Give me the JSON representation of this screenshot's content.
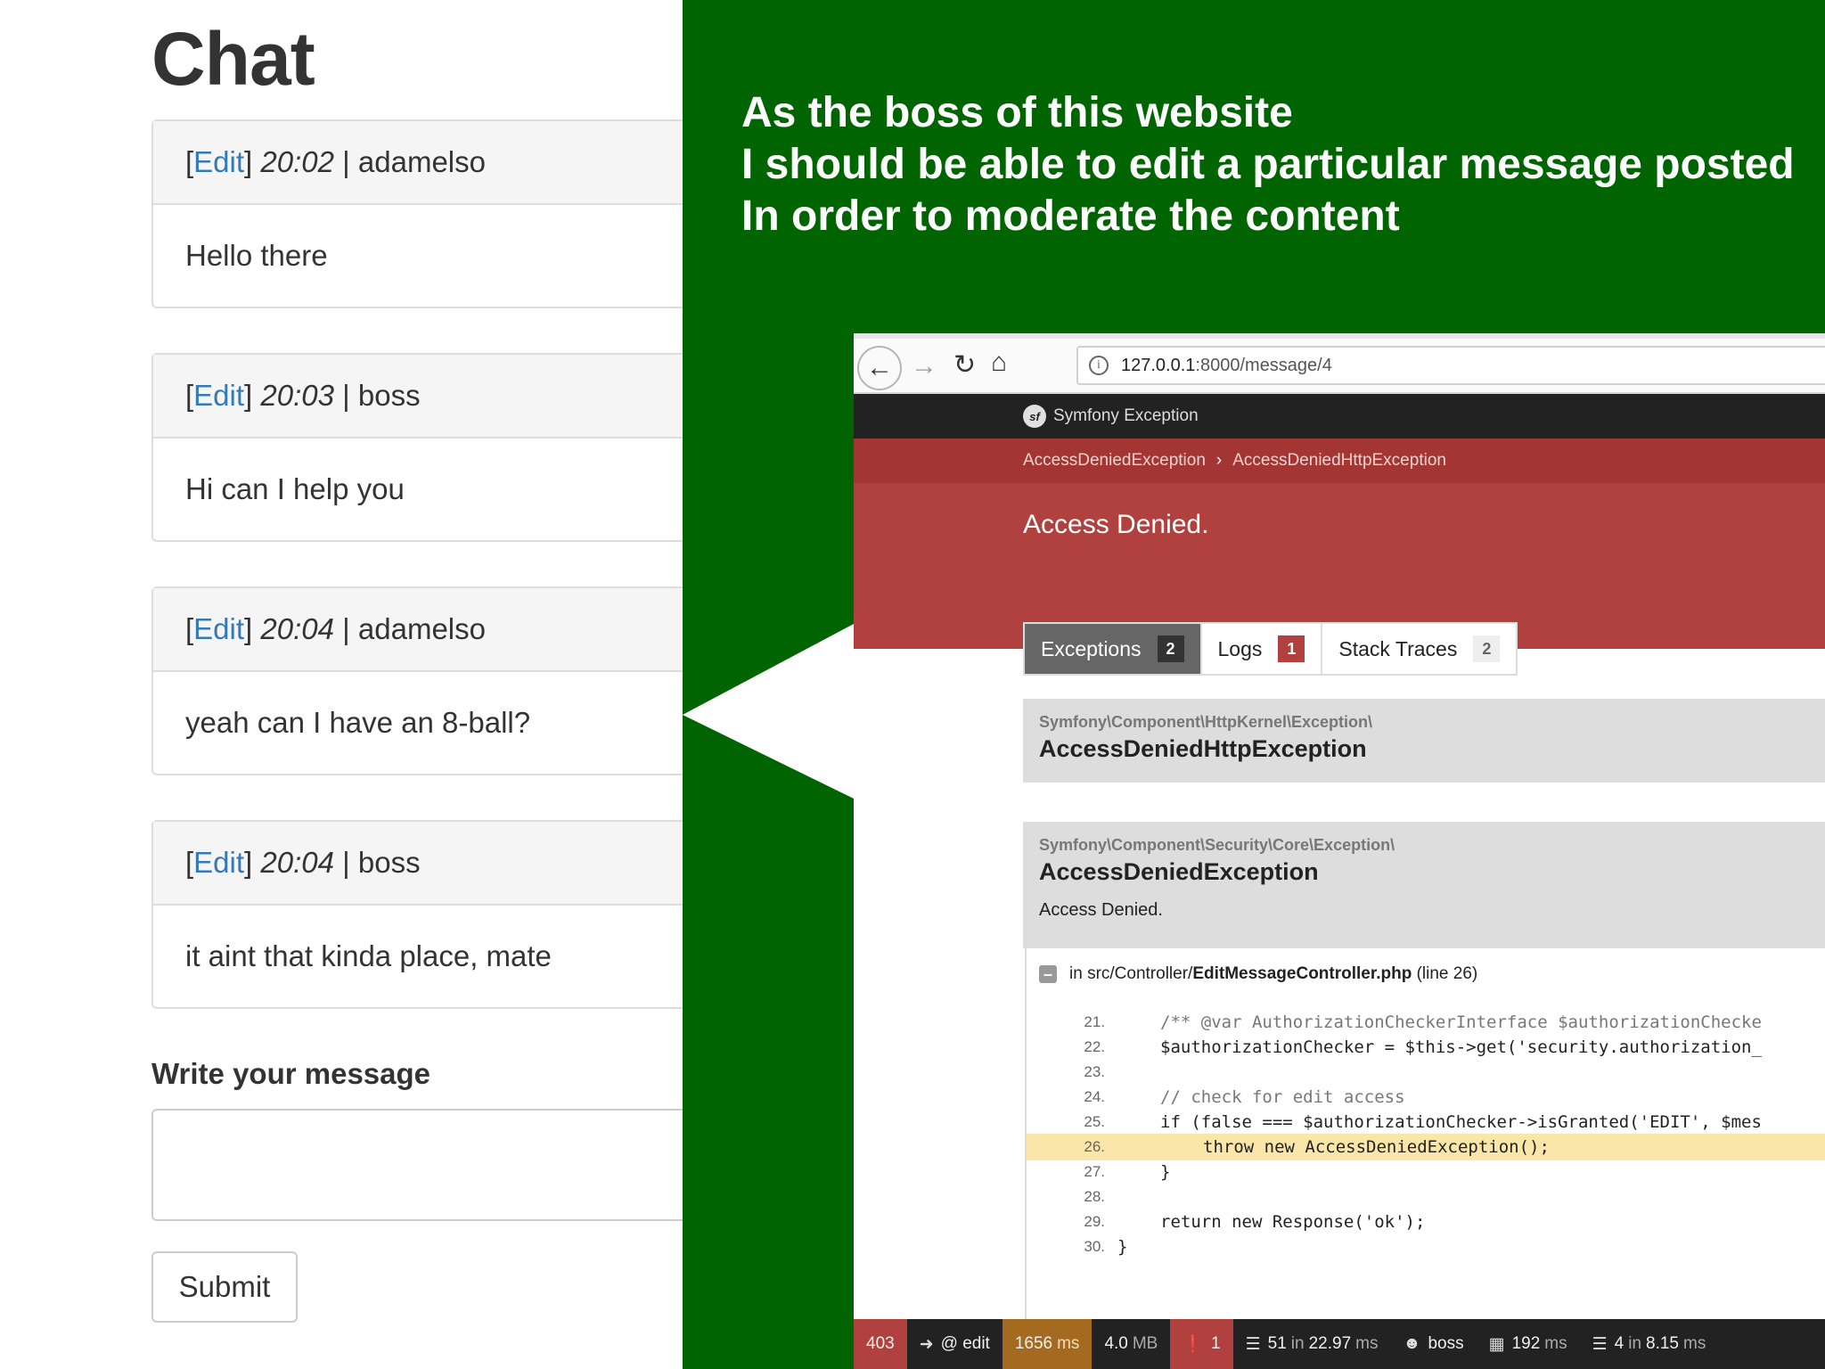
{
  "chat": {
    "title": "Chat",
    "messages": [
      {
        "edit": "Edit",
        "time": "20:02",
        "author": "adamelso",
        "text": "Hello there"
      },
      {
        "edit": "Edit",
        "time": "20:03",
        "author": "boss",
        "text": "Hi can I help you"
      },
      {
        "edit": "Edit",
        "time": "20:04",
        "author": "adamelso",
        "text": "yeah can I have an 8-ball?"
      },
      {
        "edit": "Edit",
        "time": "20:04",
        "author": "boss",
        "text": "it aint that kinda place, mate"
      }
    ],
    "compose_label": "Write your message",
    "submit_label": "Submit"
  },
  "story": {
    "line1": "As the boss of this website",
    "line2": "I should be able to edit a particular message posted",
    "line3": "In order to moderate the content"
  },
  "browser": {
    "url_host": "127.0.0.1",
    "url_path": ":8000/message/4",
    "sf_title": "Symfony Exception",
    "crumb1": "AccessDeniedException",
    "crumb2": "AccessDeniedHttpException",
    "error_message": "Access Denied.",
    "tabs": [
      {
        "label": "Exceptions",
        "count": "2"
      },
      {
        "label": "Logs",
        "count": "1"
      },
      {
        "label": "Stack Traces",
        "count": "2"
      }
    ],
    "exceptions": [
      {
        "ns": "Symfony\\Component\\HttpKernel\\Exception\\",
        "cls": "AccessDeniedHttpException"
      },
      {
        "ns": "Symfony\\Component\\Security\\Core\\Exception\\",
        "cls": "AccessDeniedException",
        "msg": "Access Denied."
      }
    ],
    "trace": {
      "prefix": "in src/Controller/",
      "file": "EditMessageController.php",
      "line_info": "(line 26)"
    },
    "code_lines": [
      {
        "n": "21.",
        "code": "/** @var AuthorizationCheckerInterface $authorizationChecke"
      },
      {
        "n": "22.",
        "code": "$authorizationChecker = $this->get('security.authorization_"
      },
      {
        "n": "23.",
        "code": ""
      },
      {
        "n": "24.",
        "code": "// check for edit access"
      },
      {
        "n": "25.",
        "code": "if (false === $authorizationChecker->isGranted('EDIT', $mes"
      },
      {
        "n": "26.",
        "code": "throw new AccessDeniedException();"
      },
      {
        "n": "27.",
        "code": "}"
      },
      {
        "n": "28.",
        "code": ""
      },
      {
        "n": "29.",
        "code": "return new Response('ok');"
      },
      {
        "n": "30.",
        "code": "}"
      }
    ],
    "debug_toolbar": {
      "status": "403",
      "route": "@ edit",
      "time": "1656",
      "time_unit": "ms",
      "memory": "4.0",
      "memory_unit": "MB",
      "errors": "1",
      "events_count": "51",
      "events_in": "in",
      "events_time": "22.97",
      "events_unit": "ms",
      "user": "boss",
      "render_time": "192",
      "render_unit": "ms",
      "db_count": "4",
      "db_in": "in",
      "db_time": "8.15",
      "db_unit": "ms"
    }
  },
  "colors": {
    "slide_green": "#006400",
    "symfony_red": "#b0413e",
    "link_blue": "#337ab7",
    "highlight_line": "#fae6a8"
  }
}
